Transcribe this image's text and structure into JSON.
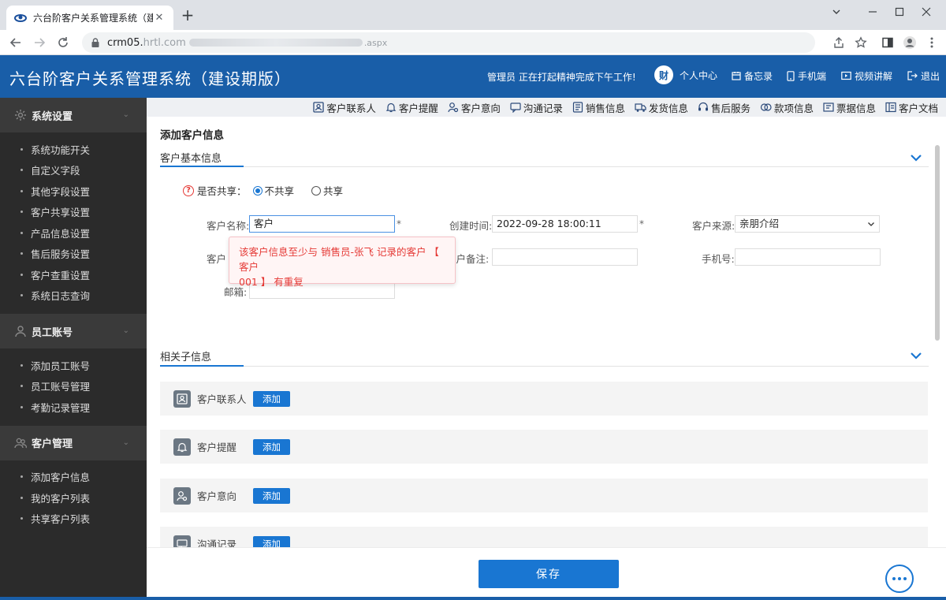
{
  "browser": {
    "tab_title": "六台阶客户关系管理系统（建设期",
    "url_visible": "crm05.",
    "url_host_partial": "hrtl.com",
    "url_tail": ".aspx"
  },
  "header": {
    "title": "六台阶客户关系管理系统（建设期版）",
    "welcome": "管理员  正在打起精神完成下午工作!",
    "avatar_text": "财",
    "items": {
      "personal": "个人中心",
      "memo": "备忘录",
      "mobile": "手机端",
      "video": "视频讲解",
      "logout": "退出"
    }
  },
  "sidebar": {
    "groups": [
      {
        "label": "系统设置",
        "items": [
          "系统功能开关",
          "自定义字段",
          "其他字段设置",
          "客户共享设置",
          "产品信息设置",
          "售后服务设置",
          "客户查重设置",
          "系统日志查询"
        ]
      },
      {
        "label": "员工账号",
        "items": [
          "添加员工账号",
          "员工账号管理",
          "考勤记录管理"
        ]
      },
      {
        "label": "客户管理",
        "items": [
          "添加客户信息",
          "我的客户列表",
          "共享客户列表"
        ]
      }
    ]
  },
  "toolbar": {
    "items": [
      "客户联系人",
      "客户提醒",
      "客户意向",
      "沟通记录",
      "销售信息",
      "发货信息",
      "售后服务",
      "款项信息",
      "票据信息",
      "客户文档"
    ]
  },
  "page": {
    "title": "添加客户信息",
    "basic_section": "客户基本信息",
    "related_section": "相关子信息"
  },
  "form": {
    "share_label": "是否共享：",
    "share_options": [
      "不共享",
      "共享"
    ],
    "share_selected": "不共享",
    "name_label": "客户名称:",
    "name_value": "客户",
    "created_label": "创建时间:",
    "created_value": "2022-09-28 18:00:11",
    "source_label": "客户来源:",
    "source_value": "亲朋介绍",
    "row2_label_partial": "客户",
    "remark_label_partial": "客户备注:",
    "phone_label": "手机号:",
    "email_label": "邮箱:",
    "required_mark": "*"
  },
  "tooltip": {
    "line1": "该客户信息至少与 销售员-张飞 记录的客户 【 客户",
    "line2": "001 】 有重复"
  },
  "related": {
    "add_label": "添加",
    "rows": [
      "客户联系人",
      "客户提醒",
      "客户意向",
      "沟通记录"
    ]
  },
  "footer": {
    "save_label": "保存"
  },
  "colors": {
    "header_blue": "#195ea8",
    "accent": "#1976d2",
    "sidebar_bg": "#2b2b2b",
    "error_red": "#e53935"
  }
}
